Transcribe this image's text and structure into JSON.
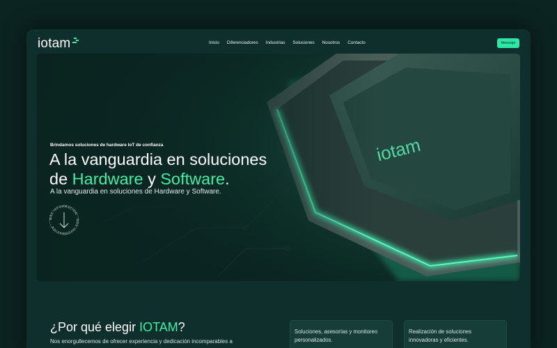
{
  "brand": {
    "name": "iotam",
    "accent": "#3ef0a8",
    "button_color": "#2ee6a6"
  },
  "nav": {
    "items": [
      "Inicio",
      "Diferenciadores",
      "Industrias",
      "Soluciones",
      "Nosotros",
      "Contacto"
    ],
    "cta": "Mensaje"
  },
  "hero": {
    "eyebrow": "Brindamos soluciones de hardware IoT de confianza",
    "title_line1": "A la vanguardia en soluciones",
    "title_de": "de ",
    "title_hw": "Hardware",
    "title_y": " y ",
    "title_sw": "Software",
    "title_dot": ".",
    "subtitle": "A la vanguardia en soluciones de Hardware y Software.",
    "badge_text": "MÁS INFORMACIÓN · MÁS INFORMACIÓN ·",
    "chip_label": "iotam"
  },
  "why": {
    "title_prefix": "¿Por qué elegir ",
    "title_brand": "IOTAM",
    "title_suffix": "?",
    "text": "Nos enorgullecemos de ofrecer experiencia y dedicación incomparables a"
  },
  "cards": [
    {
      "text": "Soluciones, asesorías y monitoreo personalizados."
    },
    {
      "text": "Realización de soluciones innovadoras y eficientes."
    }
  ]
}
